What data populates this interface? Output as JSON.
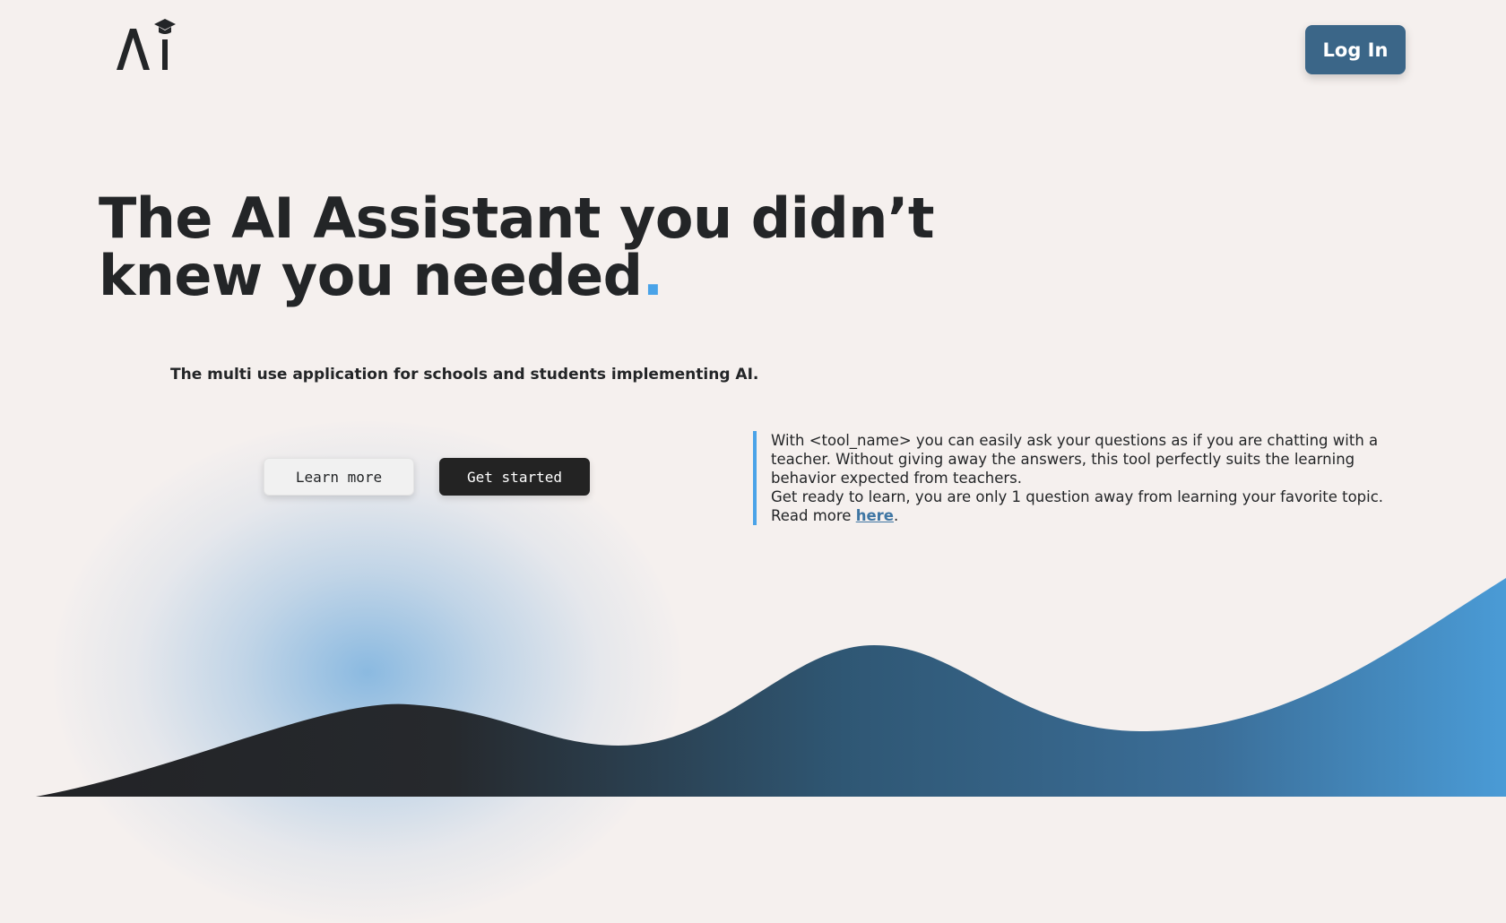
{
  "header": {
    "logo_icon": "ai-graduation-cap-logo",
    "login_label": "Log In"
  },
  "hero": {
    "headline_line1": "The AI Assistant you didn’t",
    "headline_line2": "knew you needed",
    "headline_dot": ".",
    "subtitle": "The multi use application for schools and students implementing AI.",
    "learn_more_label": "Learn more",
    "get_started_label": "Get started"
  },
  "info": {
    "paragraph1": "With <tool_name> you can easily ask your questions as if you are chatting with a teacher. Without giving away the answers, this tool perfectly suits the learning behavior expected from teachers.",
    "paragraph2": "Get ready to learn, you are only 1 question away from learning your favorite topic.",
    "read_more_prefix": "Read more ",
    "read_more_link": "here",
    "read_more_suffix": "."
  },
  "colors": {
    "background": "#f5f0ee",
    "accent_blue": "#4aa3e8",
    "login_button": "#3b6688",
    "dark": "#232323",
    "link": "#3f76a3"
  }
}
